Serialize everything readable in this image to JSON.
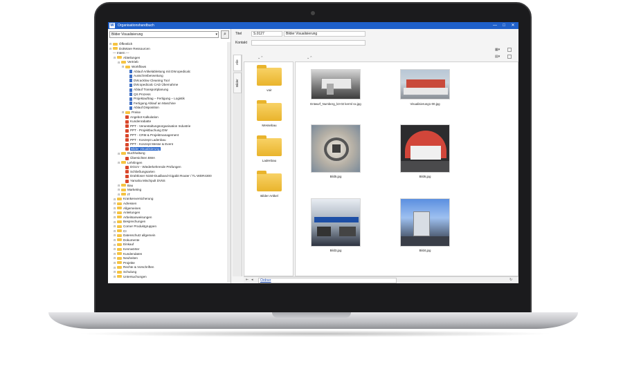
{
  "window": {
    "title": "Organisationshandbuch",
    "minimize_glyph": "—",
    "maximize_glyph": "□",
    "close_glyph": "✕"
  },
  "left_panel": {
    "select_value": "Bilder Visualisierung",
    "tree": [
      {
        "label": "Öffentlich",
        "icon": "folder",
        "level": 0
      },
      {
        "label": "DokWare Ressourcen",
        "icon": "folder",
        "level": 0
      },
      {
        "label": "--- Intern ---",
        "icon": "none",
        "level": 0
      },
      {
        "label": "Abteilungen",
        "icon": "folder",
        "level": 1
      },
      {
        "label": "Vertrieb",
        "icon": "folder",
        "level": 2
      },
      {
        "label": "Workflows",
        "icon": "folder",
        "level": 3
      },
      {
        "label": "Ablauf Artikelableitung mit DW.opedicalc",
        "icon": "doc",
        "level": 4
      },
      {
        "label": "Ausschreiberweitung",
        "icon": "doc",
        "level": 4
      },
      {
        "label": "DW.acklow Cleaning Tool",
        "icon": "doc",
        "level": 4
      },
      {
        "label": "DW.opedicalc CAD Übernahme",
        "icon": "doc",
        "level": 4
      },
      {
        "label": "Ablauf Transportplanung",
        "icon": "doc",
        "level": 4
      },
      {
        "label": "QS Prozess",
        "icon": "doc",
        "level": 4
      },
      {
        "label": "Projektauftrag – Fertigung – Logistik",
        "icon": "doc",
        "level": 4
      },
      {
        "label": "Fertigung Ablauf an Maschine",
        "icon": "doc",
        "level": 4
      },
      {
        "label": "Ablauf Disposition",
        "icon": "doc",
        "level": 4
      },
      {
        "label": "Preise",
        "icon": "folder",
        "level": 3
      },
      {
        "label": "Angebot Kalkulation",
        "icon": "red",
        "level": 3
      },
      {
        "label": "Kundenrabatte",
        "icon": "red",
        "level": 3
      },
      {
        "label": "PPT - Veranstaltungsorganisation Industrie",
        "icon": "red",
        "level": 3
      },
      {
        "label": "PPT - Projektbuchung DW",
        "icon": "red",
        "level": 3
      },
      {
        "label": "PPT - CRM & Projektmanagement",
        "icon": "red",
        "level": 3
      },
      {
        "label": "PPT - Konzept Ladenbau",
        "icon": "red",
        "level": 3
      },
      {
        "label": "PPT - Konzept Messe & Event",
        "icon": "red",
        "level": 3
      },
      {
        "label": "Bilder Visualisierung",
        "icon": "red",
        "level": 3,
        "selected": true
      },
      {
        "label": "Buchhaltung",
        "icon": "folder",
        "level": 2
      },
      {
        "label": "Übersichten BWA",
        "icon": "red",
        "level": 3
      },
      {
        "label": "Lehrlingen",
        "icon": "folder",
        "level": 2
      },
      {
        "label": "DGUV - Wiederkehrende Prüfungen",
        "icon": "red",
        "level": 3
      },
      {
        "label": "Schließungsarten",
        "icon": "red",
        "level": 3
      },
      {
        "label": "Drahtloser N150-Dualband-Gigabit Router / TL-WDR4300",
        "icon": "red",
        "level": 3
      },
      {
        "label": "Yamaha Mischpult DV5S",
        "icon": "red",
        "level": 3
      },
      {
        "label": "Bau",
        "icon": "folder",
        "level": 2
      },
      {
        "label": "Marketing",
        "icon": "folder",
        "level": 2
      },
      {
        "label": "IT",
        "icon": "folder",
        "level": 2
      },
      {
        "label": "Krankenversicherung",
        "icon": "folder",
        "level": 1
      },
      {
        "label": "Adressen",
        "icon": "folder",
        "level": 1
      },
      {
        "label": "Allgemeines",
        "icon": "folder",
        "level": 1
      },
      {
        "label": "Anleitungen",
        "icon": "folder",
        "level": 1
      },
      {
        "label": "Arbeitsanweisungen",
        "icon": "folder",
        "level": 1
      },
      {
        "label": "Besprechungen",
        "icon": "folder",
        "level": 1
      },
      {
        "label": "Corner Produktgruppen",
        "icon": "folder",
        "level": 1
      },
      {
        "label": "CI",
        "icon": "folder",
        "level": 1
      },
      {
        "label": "Datenschutz allgemein",
        "icon": "folder",
        "level": 1
      },
      {
        "label": "Dokumente",
        "icon": "folder",
        "level": 1
      },
      {
        "label": "Einkauf",
        "icon": "folder",
        "level": 1
      },
      {
        "label": "Kennwörter",
        "icon": "folder",
        "level": 1
      },
      {
        "label": "Kundendaten",
        "icon": "folder",
        "level": 1
      },
      {
        "label": "Neuheiten",
        "icon": "folder",
        "level": 1
      },
      {
        "label": "Projekte",
        "icon": "folder",
        "level": 1
      },
      {
        "label": "Rechte & Vorschriften",
        "icon": "folder",
        "level": 1
      },
      {
        "label": "Schulung",
        "icon": "folder",
        "level": 1
      },
      {
        "label": "Untersuchungen",
        "icon": "folder",
        "level": 1
      }
    ]
  },
  "details": {
    "title_label": "Titel",
    "id_value": "S.0127",
    "title_value": "Bilder Visualisierung",
    "contact_label": "Kontakt"
  },
  "side_tabs": [
    "Alle",
    "Bilder"
  ],
  "folders": [
    "voir",
    "Messebau",
    "Ladenbau",
    "Bilder Artikel"
  ],
  "images": [
    {
      "caption": "Entwurf_Numberg_k3-02 kerml sx.jpg",
      "icon": "booth-grey-image"
    },
    {
      "caption": "Visualisierung1-00.jpg",
      "icon": "booth-red-hall-image"
    },
    {
      "caption": "Bild5.jpg",
      "icon": "booth-aerial-image"
    },
    {
      "caption": "Bild6.jpg",
      "icon": "red-dome-image"
    },
    {
      "caption": "Bild3.jpg",
      "icon": "lounge-image"
    },
    {
      "caption": "Bild4.jpg",
      "icon": "blue-stage-image"
    }
  ],
  "bottom": {
    "link": "Ordner"
  },
  "colors": {
    "titlebar": "#1f60c9",
    "folder": "#f5c342",
    "selection": "#1f60c9"
  }
}
